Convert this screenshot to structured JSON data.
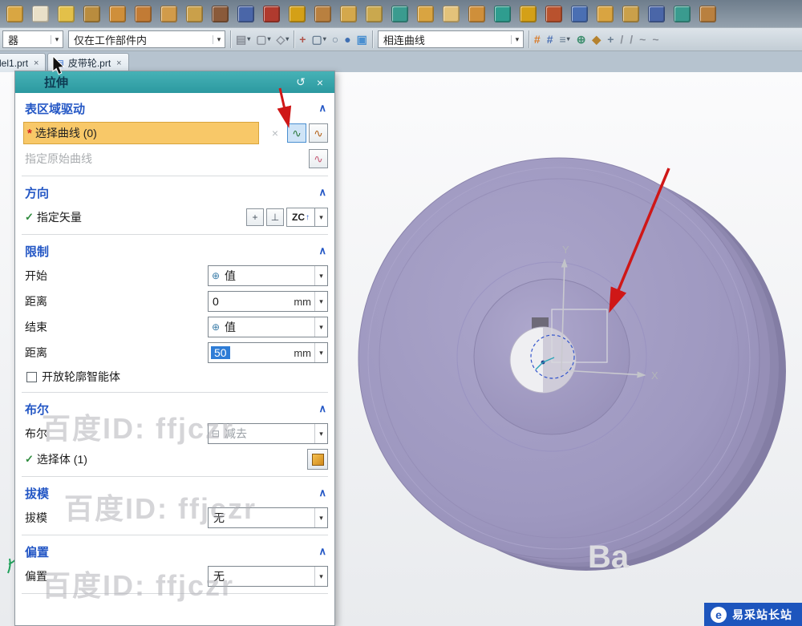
{
  "toolbar": {
    "row1_icons": [
      {
        "name": "datum-plane-icon",
        "color": "#d9a642"
      },
      {
        "name": "sketch-icon",
        "color": "#e9e0c8"
      },
      {
        "name": "sphere-feature-icon",
        "color": "#e3c049"
      },
      {
        "name": "block-feature-icon",
        "color": "#b98c3e"
      },
      {
        "name": "cylinder-feature-icon",
        "color": "#cf8f3a"
      },
      {
        "name": "extrude-icon",
        "color": "#c27b35"
      },
      {
        "name": "revolve-icon",
        "color": "#d19b4a"
      },
      {
        "name": "hole-icon",
        "color": "#caa04a"
      },
      {
        "name": "rib-icon",
        "color": "#8a5a3a"
      },
      {
        "name": "emphasis-icon",
        "color": "#4a66a8"
      },
      {
        "name": "unite-icon",
        "color": "#b03a2e"
      },
      {
        "name": "subtract-icon",
        "color": "#d4a017"
      },
      {
        "name": "intersect-icon",
        "color": "#b9803f"
      },
      {
        "name": "shell-icon",
        "color": "#d4a84c"
      },
      {
        "name": "pattern-feature-icon",
        "color": "#caa84e"
      },
      {
        "name": "mirror-feature-icon",
        "color": "#3a9b8f"
      },
      {
        "name": "edge-blend-icon",
        "color": "#d9a441"
      },
      {
        "name": "chamfer-icon",
        "color": "#e3c27a"
      },
      {
        "name": "draft-feature-icon",
        "color": "#cf8f3a"
      },
      {
        "name": "trim-body-icon",
        "color": "#2f9d8f"
      },
      {
        "name": "split-body-icon",
        "color": "#d4a017"
      },
      {
        "name": "offset-face-icon",
        "color": "#b9522e"
      },
      {
        "name": "scale-body-icon",
        "color": "#4a6fb3"
      },
      {
        "name": "tube-icon",
        "color": "#d9a441"
      },
      {
        "name": "sweep-icon",
        "color": "#caa04a"
      },
      {
        "name": "through-curves-icon",
        "color": "#4a66a8"
      },
      {
        "name": "ruled-surface-icon",
        "color": "#3a9b8f"
      },
      {
        "name": "more-features-icon",
        "color": "#b9803f"
      }
    ],
    "row2": {
      "filter_partial": "器",
      "scope": "仅在工作部件内",
      "curve_rule": "相连曲线",
      "left_icons": [
        {
          "name": "highlight-filter-icon",
          "glyph": "▤",
          "color": "#8a9099",
          "arrow": true
        },
        {
          "name": "snap-options-icon",
          "glyph": "▢",
          "color": "#8a9099",
          "arrow": true
        },
        {
          "name": "selection-scope-icon",
          "glyph": "◇",
          "color": "#8a9099",
          "arrow": true
        }
      ],
      "mid_icons": [
        {
          "name": "select-general-icon",
          "glyph": "+",
          "color": "#b0534a"
        },
        {
          "name": "rectangle-select-icon",
          "glyph": "▢",
          "color": "#6b7f93",
          "arrow": true
        },
        {
          "name": "lasso-select-icon",
          "glyph": "○",
          "color": "#6b7f93"
        },
        {
          "name": "snap-point-icon",
          "glyph": "●",
          "color": "#3f6fb3"
        },
        {
          "name": "wcs-display-icon",
          "glyph": "▣",
          "color": "#4a8fd0"
        }
      ],
      "right_icons": [
        {
          "name": "grid-snap-icon",
          "glyph": "#",
          "color": "#d97b29"
        },
        {
          "name": "grid-snap-alt-icon",
          "glyph": "#",
          "color": "#4a6fb3"
        },
        {
          "name": "snap-list-icon",
          "glyph": "≡",
          "color": "#6b7f93",
          "arrow": true
        },
        {
          "name": "point-on-curve-icon",
          "glyph": "⊕",
          "color": "#3f8f6f"
        },
        {
          "name": "midpoint-snap-icon",
          "glyph": "◆",
          "color": "#b5822e"
        },
        {
          "name": "intersection-snap-icon",
          "glyph": "+",
          "color": "#6b7f93"
        },
        {
          "name": "line-tool-icon",
          "glyph": "/",
          "color": "#8a9099"
        },
        {
          "name": "arc-tool-icon",
          "glyph": "/",
          "color": "#8a9099"
        },
        {
          "name": "curve-tool-icon",
          "glyph": "~",
          "color": "#8a9099"
        },
        {
          "name": "spline-tool-icon",
          "glyph": "~",
          "color": "#8a9099"
        }
      ]
    }
  },
  "tabs": {
    "tab1": "del1.prt",
    "tab2": "皮带轮.prt"
  },
  "dialog": {
    "title": "拉伸",
    "section_region": {
      "title": "表区域驱动",
      "select_curve": "选择曲线 (0)",
      "origin_curve": "指定原始曲线"
    },
    "direction": {
      "title": "方向",
      "specify_vector": "指定矢量",
      "vector": "ZC"
    },
    "limits": {
      "title": "限制",
      "start_label": "开始",
      "start_mode": "值",
      "dist1_label": "距离",
      "dist1_value": "0",
      "end_label": "结束",
      "end_mode": "值",
      "dist2_label": "距离",
      "dist2_value": "50",
      "unit": "mm",
      "open_profile": "开放轮廓智能体"
    },
    "boolean": {
      "title": "布尔",
      "label": "布尔",
      "mode": "减去",
      "select_body": "选择体 (1)"
    },
    "draft": {
      "title": "拔模",
      "label": "拔模",
      "mode": "无"
    },
    "offset": {
      "title": "偏置",
      "label": "偏置",
      "mode": "无"
    }
  },
  "viewport": {
    "axis_x": "X",
    "axis_y": "Y",
    "faint_text": "Ba"
  },
  "watermark": {
    "text": "百度ID: ffjczr"
  },
  "badge": {
    "text": "易采站长站"
  }
}
